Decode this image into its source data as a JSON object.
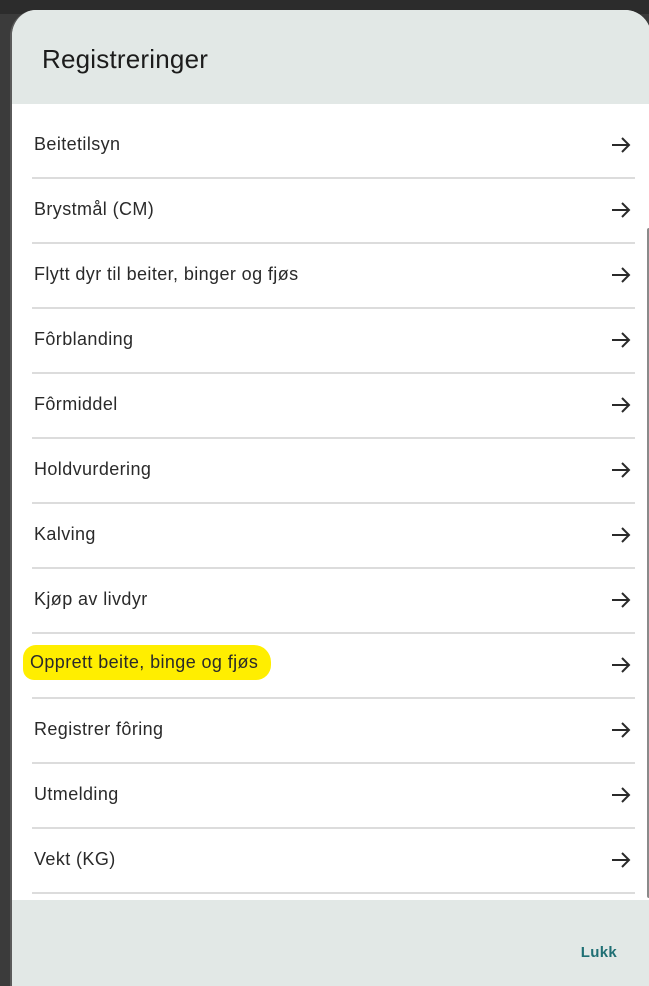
{
  "dialog": {
    "title": "Registreringer",
    "close_label": "Lukk"
  },
  "items": [
    {
      "label": "Beitetilsyn",
      "highlighted": false
    },
    {
      "label": "Brystmål (CM)",
      "highlighted": false
    },
    {
      "label": "Flytt dyr til beiter, binger og fjøs",
      "highlighted": false
    },
    {
      "label": "Fôrblanding",
      "highlighted": false
    },
    {
      "label": "Fôrmiddel",
      "highlighted": false
    },
    {
      "label": "Holdvurdering",
      "highlighted": false
    },
    {
      "label": "Kalving",
      "highlighted": false
    },
    {
      "label": "Kjøp av livdyr",
      "highlighted": false
    },
    {
      "label": "Opprett beite, binge og fjøs",
      "highlighted": true
    },
    {
      "label": "Registrer fôring",
      "highlighted": false
    },
    {
      "label": "Utmelding",
      "highlighted": false
    },
    {
      "label": "Vekt (KG)",
      "highlighted": false
    }
  ],
  "icons": {
    "item_trailing": "arrow-right-icon"
  },
  "colors": {
    "header_bg": "#e2e8e6",
    "accent": "#1f6f74",
    "highlight": "#ffee00"
  }
}
